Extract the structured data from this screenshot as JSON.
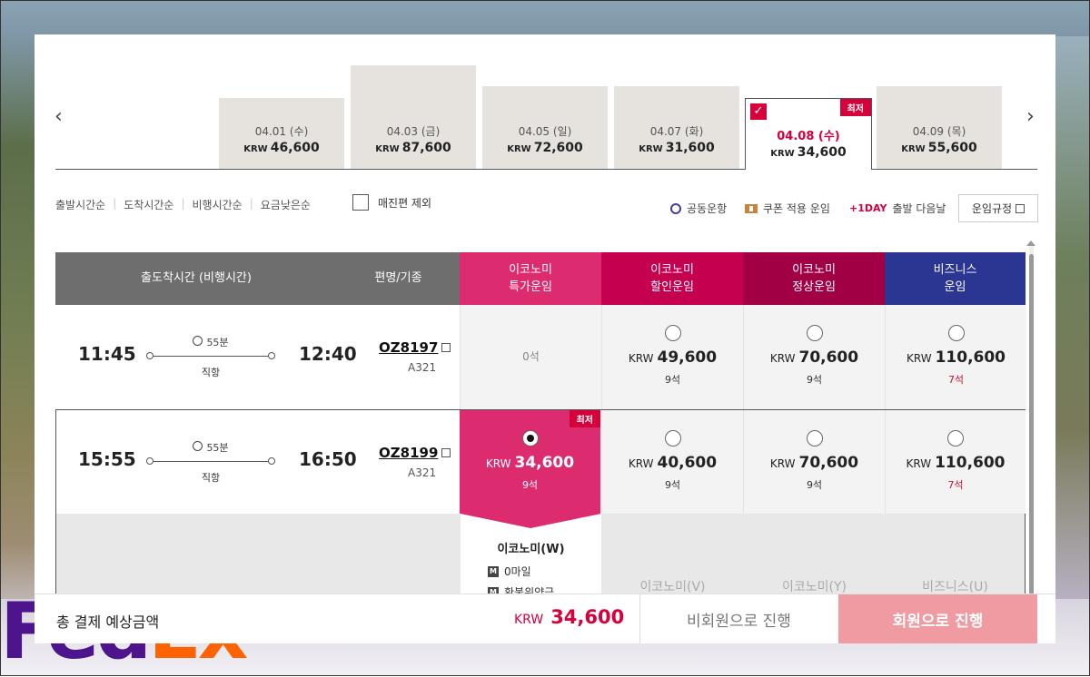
{
  "dates": [
    {
      "date": "04.01 (수)",
      "currency": "KRW",
      "price": "46,600"
    },
    {
      "date": "04.03 (금)",
      "currency": "KRW",
      "price": "87,600"
    },
    {
      "date": "04.05 (일)",
      "currency": "KRW",
      "price": "72,600"
    },
    {
      "date": "04.07 (화)",
      "currency": "KRW",
      "price": "31,600"
    },
    {
      "date": "04.08 (수)",
      "currency": "KRW",
      "price": "34,600",
      "tag": "최저",
      "check": "✓"
    },
    {
      "date": "04.09 (목)",
      "currency": "KRW",
      "price": "55,600"
    }
  ],
  "sort": {
    "departure": "출발시간순",
    "arrival": "도착시간순",
    "duration": "비행시간순",
    "fare": "요금낮은순",
    "exclude_soldout": "매진편 제외"
  },
  "legend": {
    "codeshare": "공동운항",
    "coupon": "쿠폰 적용 운임",
    "plus_day": "+1DAY",
    "plus_day_text": "출발 다음날",
    "fare_rules": "운임규정"
  },
  "headers": {
    "time": "출도착시간 (비행시간)",
    "flight": "편명/기종",
    "eco_special_1": "이코노미",
    "eco_special_2": "특가운임",
    "eco_discount_1": "이코노미",
    "eco_discount_2": "할인운임",
    "eco_normal_1": "이코노미",
    "eco_normal_2": "정상운임",
    "business_1": "비즈니스",
    "business_2": "운임"
  },
  "flights": [
    {
      "dep": "11:45",
      "arr": "12:40",
      "duration": "55분",
      "type": "직항",
      "flight_no": "OZ8197",
      "aircraft": "A321",
      "special": {
        "seats": "0석"
      },
      "discount": {
        "currency": "KRW",
        "price": "49,600",
        "seats": "9석"
      },
      "normal": {
        "currency": "KRW",
        "price": "70,600",
        "seats": "9석"
      },
      "business": {
        "currency": "KRW",
        "price": "110,600",
        "seats": "7석"
      }
    },
    {
      "dep": "15:55",
      "arr": "16:50",
      "duration": "55분",
      "type": "직항",
      "flight_no": "OZ8199",
      "aircraft": "A321",
      "special": {
        "currency": "KRW",
        "price": "34,600",
        "seats": "9석",
        "tag": "최저"
      },
      "discount": {
        "currency": "KRW",
        "price": "40,600",
        "seats": "9석"
      },
      "normal": {
        "currency": "KRW",
        "price": "70,600",
        "seats": "9석"
      },
      "business": {
        "currency": "KRW",
        "price": "110,600",
        "seats": "7석"
      }
    }
  ],
  "detail": {
    "title": "이코노미(W)",
    "mileage": "0마일",
    "refund": "환불위약금",
    "other_v": "이코노미(V)",
    "other_y": "이코노미(Y)",
    "other_u": "비즈니스(U)"
  },
  "footer": {
    "total_label": "총 결제 예상금액",
    "currency": "KRW",
    "total": "34,600",
    "guest_btn": "비회원으로 진행",
    "member_btn": "회원으로 진행"
  },
  "colors": {
    "eco_special": "#dc2c6f",
    "eco_discount": "#c4004f",
    "eco_normal": "#a10045",
    "business": "#2b3592",
    "accent_red": "#d6003b"
  },
  "background": {
    "logo_fe": "Fed",
    "logo_ex": "Ex"
  }
}
